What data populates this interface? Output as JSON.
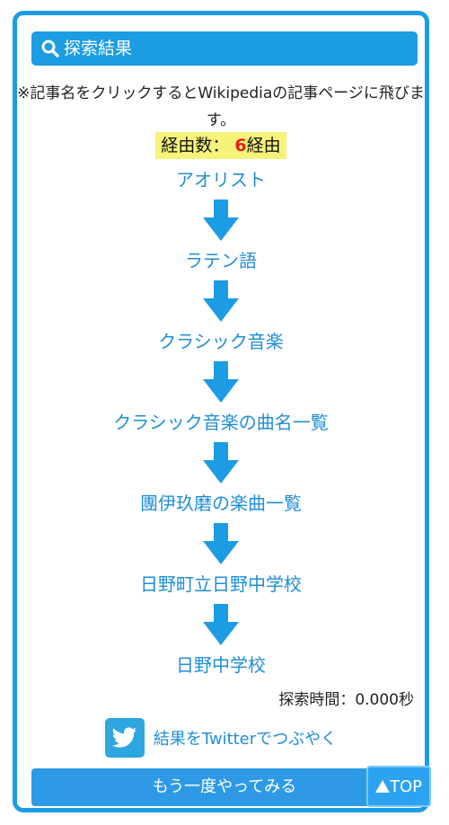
{
  "header": {
    "title": "探索結果",
    "icon": "search-icon"
  },
  "note": "※記事名をクリックするとWikipediaの記事ページに飛びます。",
  "count": {
    "label": "経由数：",
    "value": "6",
    "suffix": "経由"
  },
  "route": [
    "アオリスト",
    "ラテン語",
    "クラシック音楽",
    "クラシック音楽の曲名一覧",
    "團伊玖磨の楽曲一覧",
    "日野町立日野中学校",
    "日野中学校"
  ],
  "time": "探索時間：0.000秒",
  "tweet": {
    "label": "結果をTwitterでつぶやく",
    "icon": "twitter-bird-icon"
  },
  "retry_label": "もう一度やってみる",
  "top_button": {
    "label": "TOP",
    "icon": "triangle-up-icon"
  },
  "colors": {
    "accent": "#1a9de3",
    "link": "#1f8ed8",
    "highlight": "#f6f27a",
    "count_number": "#e3201c"
  }
}
